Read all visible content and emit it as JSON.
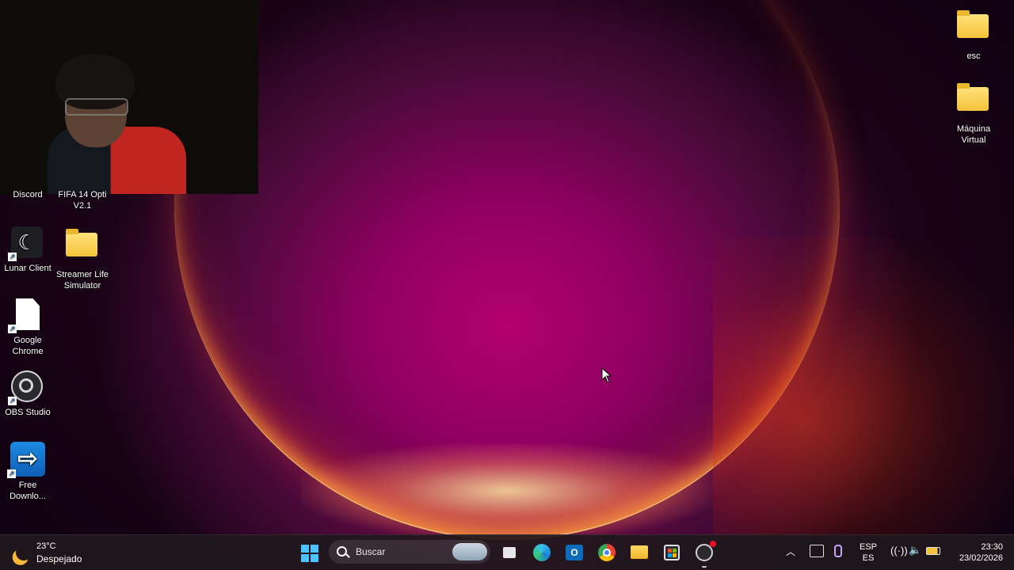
{
  "desktop": {
    "icons_left": [
      {
        "label": "Discord"
      },
      {
        "label": "FIFA 14 Opti V2.1"
      },
      {
        "label": "Lunar Client"
      },
      {
        "label": "Streamer Life Simulator"
      },
      {
        "label": "Google Chrome"
      },
      {
        "label": "OBS Studio"
      },
      {
        "label": "Free Downlo..."
      }
    ],
    "icons_right": [
      {
        "label": "esc"
      },
      {
        "label": "Máquina Virtual"
      }
    ]
  },
  "taskbar": {
    "weather_temp": "23°C",
    "weather_desc": "Despejado",
    "search_placeholder": "Buscar",
    "pinned": [
      "start-icon",
      "task-view-icon",
      "edge-icon",
      "outlook-icon",
      "chrome-icon",
      "file-explorer-icon",
      "store-icon",
      "obs-icon"
    ],
    "lang_top": "ESP",
    "lang_bottom": "ES",
    "time": "23:30",
    "date": "23/02/2026"
  },
  "colors": {
    "accent": "#4cc2ff",
    "folder": "#f5c33b",
    "taskbar": "#20181c"
  }
}
